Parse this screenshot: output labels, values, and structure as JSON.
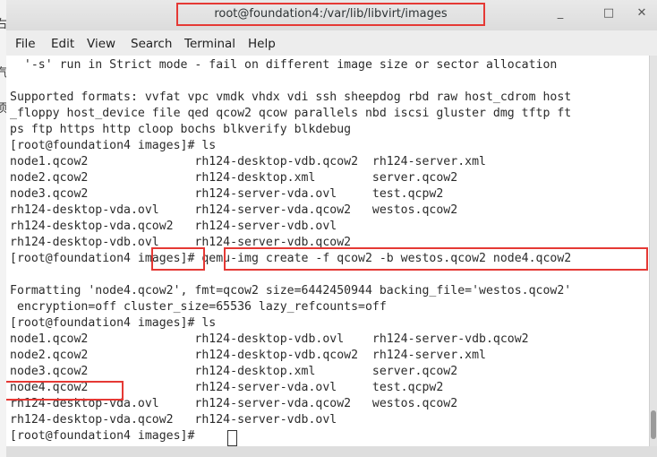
{
  "window": {
    "title": "root@foundation4:/var/lib/libvirt/images",
    "minimize_glyph": "_",
    "maximize_glyph": "□",
    "close_glyph": "✕"
  },
  "menu": [
    "File",
    "Edit",
    "View",
    "Search",
    "Terminal",
    "Help"
  ],
  "left_strip": [
    "右",
    "汽",
    "项"
  ],
  "terminal_lines": [
    "  '-s' run in Strict mode - fail on different image size or sector allocation",
    "",
    "Supported formats: vvfat vpc vmdk vhdx vdi ssh sheepdog rbd raw host_cdrom host",
    "_floppy host_device file qed qcow2 qcow parallels nbd iscsi gluster dmg tftp ft",
    "ps ftp https http cloop bochs blkverify blkdebug",
    "[root@foundation4 images]# ls",
    "node1.qcow2               rh124-desktop-vdb.qcow2  rh124-server.xml",
    "node2.qcow2               rh124-desktop.xml        server.qcow2",
    "node3.qcow2               rh124-server-vda.ovl     test.qcpw2",
    "rh124-desktop-vda.ovl     rh124-server-vda.qcow2   westos.qcow2",
    "rh124-desktop-vda.qcow2   rh124-server-vdb.ovl",
    "rh124-desktop-vdb.ovl     rh124-server-vdb.qcow2",
    "[root@foundation4 images]# qemu-img create -f qcow2 -b westos.qcow2 node4.qcow2",
    "",
    "Formatting 'node4.qcow2', fmt=qcow2 size=6442450944 backing_file='westos.qcow2'",
    " encryption=off cluster_size=65536 lazy_refcounts=off",
    "[root@foundation4 images]# ls",
    "node1.qcow2               rh124-desktop-vdb.ovl    rh124-server-vdb.qcow2",
    "node2.qcow2               rh124-desktop-vdb.qcow2  rh124-server.xml",
    "node3.qcow2               rh124-desktop.xml        server.qcow2",
    "node4.qcow2               rh124-server-vda.ovl     test.qcpw2",
    "rh124-desktop-vda.ovl     rh124-server-vda.qcow2   westos.qcow2",
    "rh124-desktop-vda.qcow2   rh124-server-vdb.ovl",
    "[root@foundation4 images]# "
  ],
  "colors": {
    "highlight": "#e53935",
    "terminal_bg": "#ffffff",
    "terminal_fg": "#2b2b2b"
  },
  "icons": [
    "minimize-icon",
    "maximize-icon",
    "close-icon"
  ]
}
